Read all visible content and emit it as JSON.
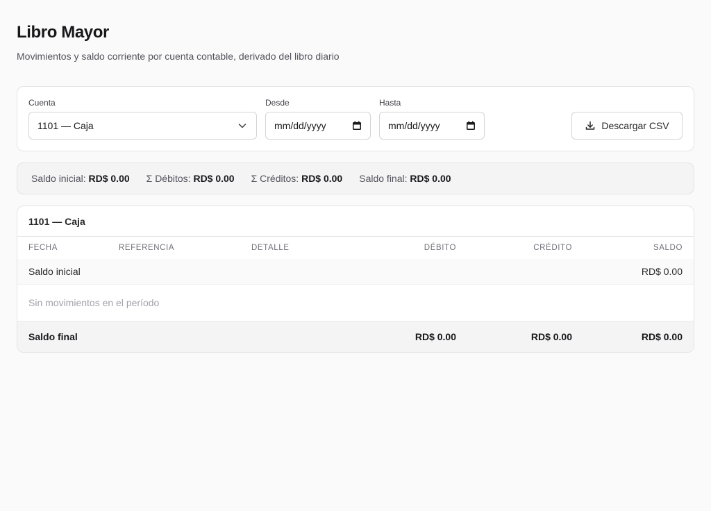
{
  "header": {
    "title": "Libro Mayor",
    "subtitle": "Movimientos y saldo corriente por cuenta contable, derivado del libro diario"
  },
  "filters": {
    "account_label": "Cuenta",
    "account_value": "1101 — Caja",
    "from_label": "Desde",
    "from_value": "mm/dd/yyyy",
    "to_label": "Hasta",
    "to_value": "mm/dd/yyyy",
    "download_label": "Descargar CSV"
  },
  "summary": {
    "opening_label": "Saldo inicial:",
    "opening_value": "RD$ 0.00",
    "debits_label": "Σ Débitos:",
    "debits_value": "RD$ 0.00",
    "credits_label": "Σ Créditos:",
    "credits_value": "RD$ 0.00",
    "closing_label": "Saldo final:",
    "closing_value": "RD$ 0.00"
  },
  "ledger": {
    "account_title": "1101 — Caja",
    "columns": [
      "FECHA",
      "REFERENCIA",
      "DETALLE",
      "DÉBITO",
      "CRÉDITO",
      "SALDO"
    ],
    "opening_row": {
      "label": "Saldo inicial",
      "balance": "RD$ 0.00"
    },
    "empty_text": "Sin movimientos en el período",
    "closing_row": {
      "label": "Saldo final",
      "debit": "RD$ 0.00",
      "credit": "RD$ 0.00",
      "balance": "RD$ 0.00"
    }
  },
  "icons": {
    "select": "chevron-down-icon",
    "date": "calendar-icon",
    "download": "download-icon"
  }
}
